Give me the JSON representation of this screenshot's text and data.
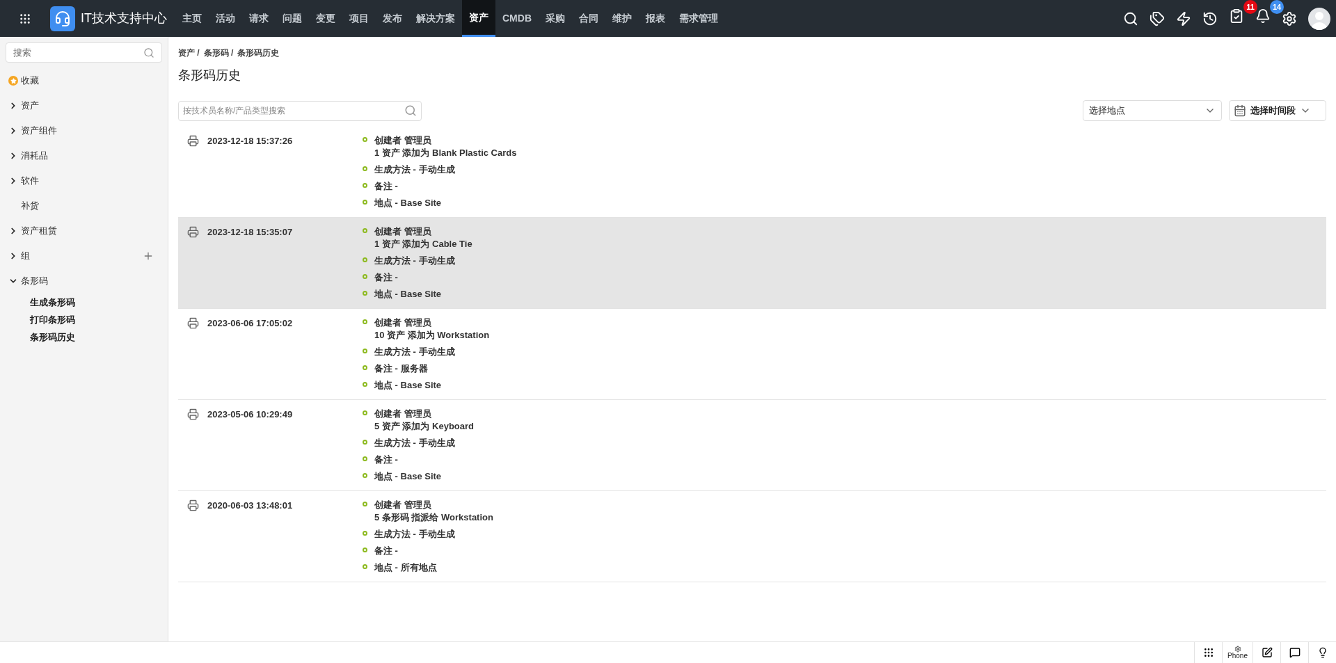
{
  "header": {
    "title": "IT技术支持中心",
    "nav": [
      {
        "label": "主页",
        "selected": false
      },
      {
        "label": "活动",
        "selected": false
      },
      {
        "label": "请求",
        "selected": false
      },
      {
        "label": "问题",
        "selected": false
      },
      {
        "label": "变更",
        "selected": false
      },
      {
        "label": "项目",
        "selected": false
      },
      {
        "label": "发布",
        "selected": false
      },
      {
        "label": "解决方案",
        "selected": false
      },
      {
        "label": "资产",
        "selected": true
      },
      {
        "label": "CMDB",
        "selected": false
      },
      {
        "label": "采购",
        "selected": false
      },
      {
        "label": "合同",
        "selected": false
      },
      {
        "label": "维护",
        "selected": false
      },
      {
        "label": "报表",
        "selected": false
      },
      {
        "label": "需求管理",
        "selected": false
      }
    ],
    "tasks_badge": "11",
    "notifications_badge": "14"
  },
  "sidebar": {
    "search": {
      "placeholder": "搜索"
    },
    "items": [
      {
        "kind": "favorite",
        "label": "收藏"
      },
      {
        "kind": "group",
        "label": "资产",
        "expanded": false
      },
      {
        "kind": "group",
        "label": "资产组件",
        "expanded": false
      },
      {
        "kind": "group",
        "label": "消耗品",
        "expanded": false
      },
      {
        "kind": "group",
        "label": "软件",
        "expanded": false
      },
      {
        "kind": "plain",
        "label": "补货"
      },
      {
        "kind": "group",
        "label": "资产租赁",
        "expanded": false
      },
      {
        "kind": "group",
        "label": "组",
        "expanded": false,
        "addable": true
      },
      {
        "kind": "group",
        "label": "条形码",
        "expanded": true,
        "children": [
          {
            "label": "生成条形码"
          },
          {
            "label": "打印条形码"
          },
          {
            "label": "条形码历史"
          }
        ]
      }
    ]
  },
  "breadcrumb": [
    "资产 /",
    "条形码 /",
    "条形码历史"
  ],
  "page_title": "条形码历史",
  "search": {
    "placeholder": "按技术员名称/产品类型搜索"
  },
  "location_select": "选择地点",
  "period_select": "选择时间段",
  "records": [
    {
      "time": "2023-12-18 15:37:26",
      "highlighted": false,
      "lines": [
        "创建者 管理员\n1 资产 添加为 Blank Plastic Cards",
        "生成方法 - 手动生成",
        "备注 -",
        "地点 - Base Site"
      ]
    },
    {
      "time": "2023-12-18 15:35:07",
      "highlighted": true,
      "lines": [
        "创建者 管理员\n1 资产 添加为 Cable Tie",
        "生成方法 - 手动生成",
        "备注 -",
        "地点 - Base Site"
      ]
    },
    {
      "time": "2023-06-06 17:05:02",
      "highlighted": false,
      "lines": [
        "创建者 管理员\n10 资产 添加为 Workstation",
        "生成方法 - 手动生成",
        "备注 - 服务器",
        "地点 - Base Site"
      ]
    },
    {
      "time": "2023-05-06 10:29:49",
      "highlighted": false,
      "lines": [
        "创建者 管理员\n5 资产 添加为 Keyboard",
        "生成方法 - 手动生成",
        "备注 -",
        "地点 - Base Site"
      ]
    },
    {
      "time": "2020-06-03 13:48:01",
      "highlighted": false,
      "lines": [
        "创建者 管理员\n5 条形码 指派给 Workstation",
        "生成方法 - 手动生成",
        "备注 -",
        "地点 - 所有地点"
      ]
    }
  ],
  "footer": {
    "phone_label": "Phone"
  }
}
